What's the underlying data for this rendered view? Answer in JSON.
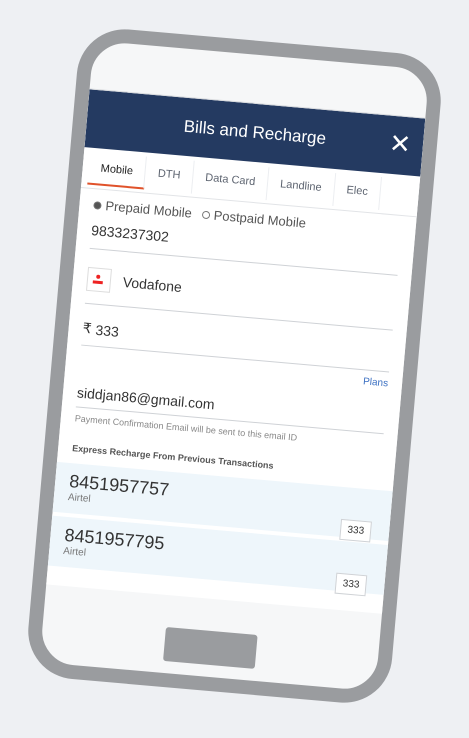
{
  "header": {
    "title": "Bills and Recharge",
    "close_icon": "close-icon"
  },
  "tabs": [
    "Mobile",
    "DTH",
    "Data Card",
    "Landline",
    "Elec"
  ],
  "form": {
    "radio_prepaid": "Prepaid Mobile",
    "radio_postpaid": "Postpaid Mobile",
    "mobile_number": "9833237302",
    "operator": "Vodafone",
    "currency_symbol": "₹",
    "amount": "333",
    "plans_label": "Plans",
    "email": "siddjan86@gmail.com",
    "email_hint": "Payment Confirmation Email will be sent to this email ID"
  },
  "express": {
    "title": "Express Recharge From Previous Transactions",
    "items": [
      {
        "number": "8451957757",
        "operator": "Airtel",
        "amount": "333"
      },
      {
        "number": "8451957795",
        "operator": "Airtel",
        "amount": "333"
      }
    ]
  },
  "colors": {
    "header": "#243a61",
    "accent": "#e0522a",
    "frame": "#9a9c9f",
    "link": "#3a6fc2"
  }
}
